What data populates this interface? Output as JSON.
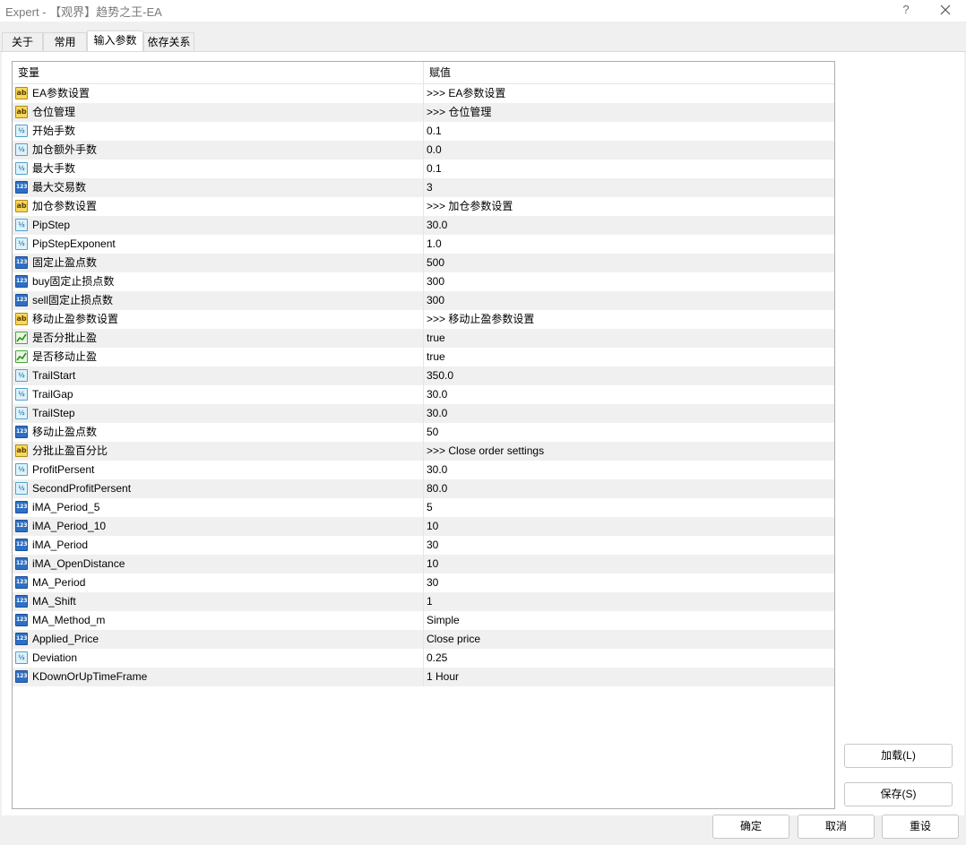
{
  "window": {
    "title": "Expert - 【观界】趋势之王-EA",
    "help": "?"
  },
  "tabs": [
    {
      "label": "关于"
    },
    {
      "label": "常用"
    },
    {
      "label": "输入参数",
      "active": true
    },
    {
      "label": "依存关系"
    }
  ],
  "grid": {
    "headers": {
      "variable": "变量",
      "value": "赋值"
    },
    "rows": [
      {
        "type": "string",
        "name": "EA参数设置",
        "value": ">>> EA参数设置"
      },
      {
        "type": "string",
        "name": "仓位管理",
        "value": ">>> 仓位管理"
      },
      {
        "type": "double",
        "name": "开始手数",
        "value": "0.1"
      },
      {
        "type": "double",
        "name": "加仓额外手数",
        "value": "0.0"
      },
      {
        "type": "double",
        "name": "最大手数",
        "value": "0.1"
      },
      {
        "type": "int",
        "name": "最大交易数",
        "value": "3"
      },
      {
        "type": "string",
        "name": "加仓参数设置",
        "value": ">>> 加仓参数设置"
      },
      {
        "type": "double",
        "name": "PipStep",
        "value": "30.0"
      },
      {
        "type": "double",
        "name": "PipStepExponent",
        "value": "1.0"
      },
      {
        "type": "int",
        "name": "固定止盈点数",
        "value": "500"
      },
      {
        "type": "int",
        "name": "buy固定止损点数",
        "value": "300"
      },
      {
        "type": "int",
        "name": "sell固定止损点数",
        "value": "300"
      },
      {
        "type": "string",
        "name": "移动止盈参数设置",
        "value": ">>> 移动止盈参数设置"
      },
      {
        "type": "bool",
        "name": "是否分批止盈",
        "value": "true"
      },
      {
        "type": "bool",
        "name": "是否移动止盈",
        "value": "true"
      },
      {
        "type": "double",
        "name": "TrailStart",
        "value": "350.0"
      },
      {
        "type": "double",
        "name": "TrailGap",
        "value": "30.0"
      },
      {
        "type": "double",
        "name": "TrailStep",
        "value": "30.0"
      },
      {
        "type": "int",
        "name": "移动止盈点数",
        "value": "50"
      },
      {
        "type": "string",
        "name": "分批止盈百分比",
        "value": ">>> Close order settings"
      },
      {
        "type": "double",
        "name": "ProfitPersent",
        "value": "30.0"
      },
      {
        "type": "double",
        "name": "SecondProfitPersent",
        "value": "80.0"
      },
      {
        "type": "int",
        "name": "iMA_Period_5",
        "value": "5"
      },
      {
        "type": "int",
        "name": "iMA_Period_10",
        "value": "10"
      },
      {
        "type": "int",
        "name": "iMA_Period",
        "value": "30"
      },
      {
        "type": "int",
        "name": "iMA_OpenDistance",
        "value": "10"
      },
      {
        "type": "int",
        "name": "MA_Period",
        "value": "30"
      },
      {
        "type": "int",
        "name": "MA_Shift",
        "value": "1"
      },
      {
        "type": "int",
        "name": "MA_Method_m",
        "value": "Simple"
      },
      {
        "type": "int",
        "name": "Applied_Price",
        "value": "Close price"
      },
      {
        "type": "double",
        "name": "Deviation",
        "value": "0.25"
      },
      {
        "type": "int",
        "name": "KDownOrUpTimeFrame",
        "value": "1 Hour"
      }
    ]
  },
  "side_buttons": {
    "load": "加载(L)",
    "save": "保存(S)"
  },
  "footer_buttons": {
    "ok": "确定",
    "cancel": "取消",
    "reset": "重设"
  },
  "icon_text": {
    "string": "ab",
    "double": "½",
    "int": "123"
  }
}
